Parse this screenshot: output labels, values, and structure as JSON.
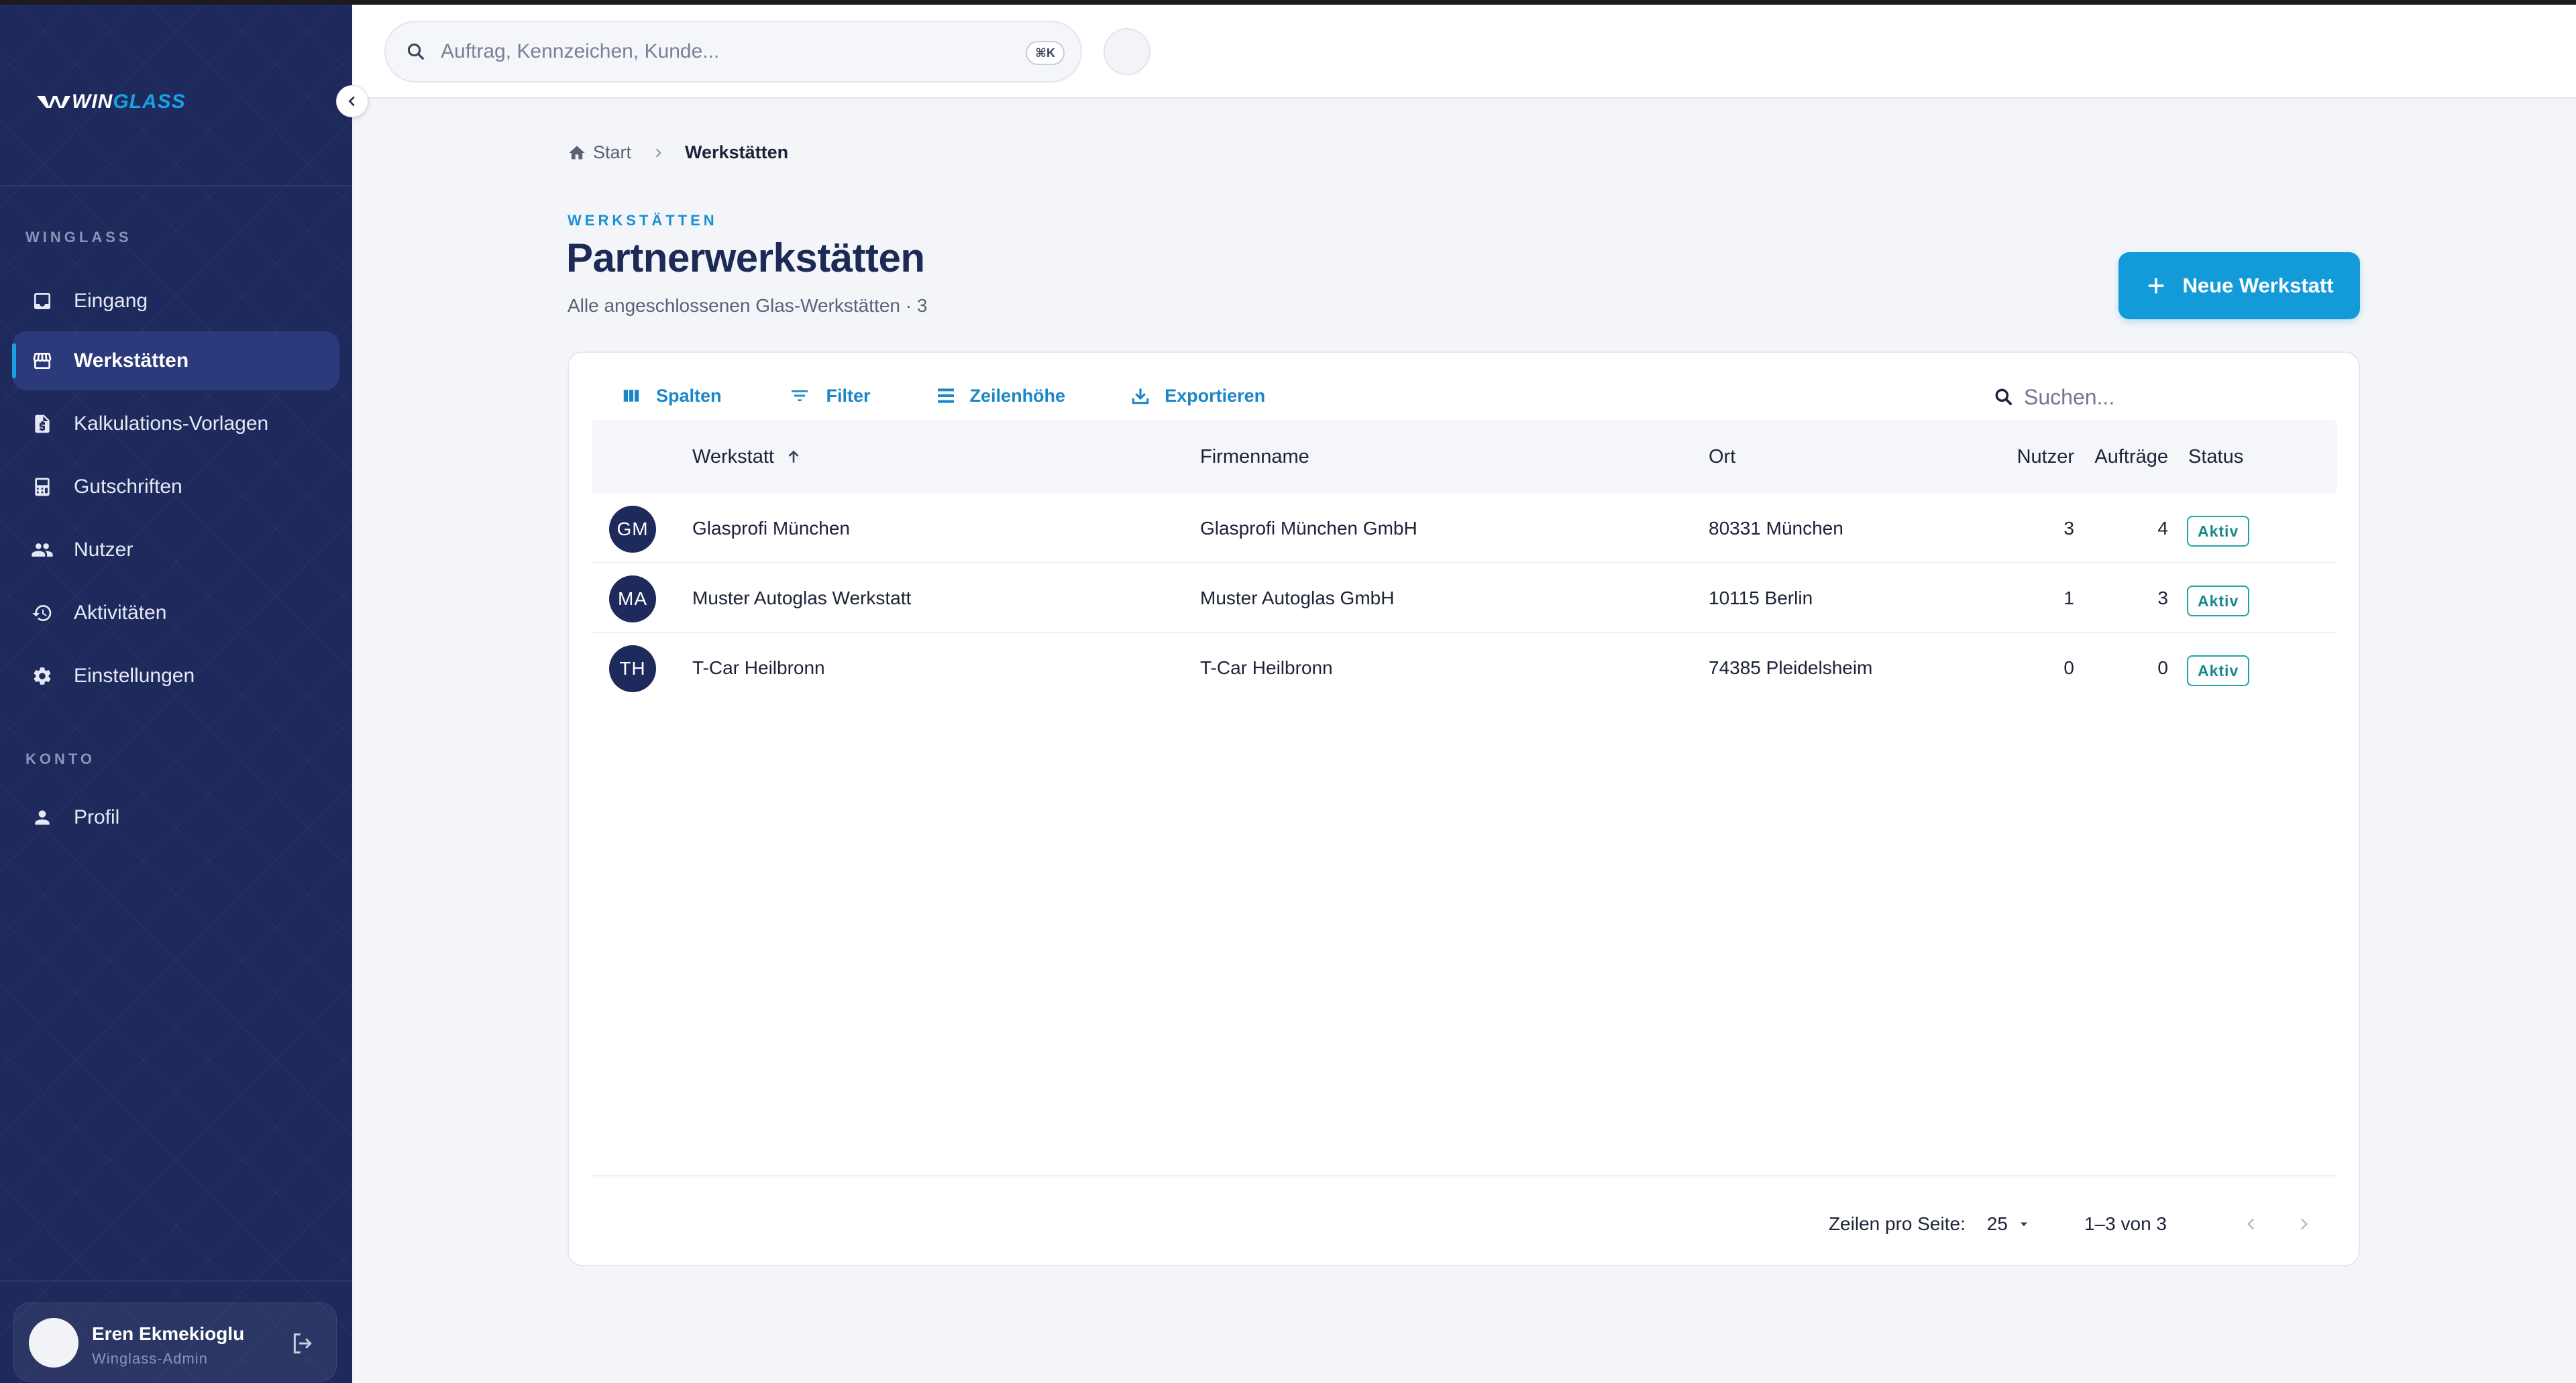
{
  "app": {
    "logo_primary": "WIN",
    "logo_secondary": "GLASS"
  },
  "header": {
    "search_placeholder": "Auftrag, Kennzeichen, Kunde...",
    "shortcut": "⌘K"
  },
  "sidebar": {
    "section_main": "WINGLASS",
    "section_account": "KONTO",
    "items": [
      {
        "label": "Eingang",
        "icon": "inbox-icon"
      },
      {
        "label": "Werkstätten",
        "icon": "store-icon",
        "active": true
      },
      {
        "label": "Kalkulations-Vorlagen",
        "icon": "document-dollar-icon"
      },
      {
        "label": "Gutschriften",
        "icon": "receipt-icon"
      },
      {
        "label": "Nutzer",
        "icon": "users-icon"
      },
      {
        "label": "Aktivitäten",
        "icon": "history-icon"
      },
      {
        "label": "Einstellungen",
        "icon": "gear-icon"
      }
    ],
    "account_items": [
      {
        "label": "Profil",
        "icon": "person-icon"
      }
    ],
    "user": {
      "name": "Eren Ekmekioglu",
      "role": "Winglass-Admin"
    }
  },
  "breadcrumb": {
    "home": "Start",
    "current": "Werkstätten"
  },
  "page": {
    "eyebrow": "WERKSTÄTTEN",
    "title": "Partnerwerkstätten",
    "subtitle": "Alle angeschlossenen Glas-Werkstätten · 3",
    "new_button": "Neue Werkstatt"
  },
  "toolbar": {
    "columns": "Spalten",
    "filter": "Filter",
    "row_height": "Zeilenhöhe",
    "export": "Exportieren",
    "search_placeholder": "Suchen..."
  },
  "table": {
    "headers": {
      "workshop": "Werkstatt",
      "company": "Firmenname",
      "city": "Ort",
      "users": "Nutzer",
      "orders": "Aufträge",
      "status": "Status"
    },
    "rows": [
      {
        "initials": "GM",
        "workshop": "Glasprofi München",
        "company": "Glasprofi München GmbH",
        "city": "80331 München",
        "users": "3",
        "orders": "4",
        "status": "Aktiv"
      },
      {
        "initials": "MA",
        "workshop": "Muster Autoglas Werkstatt",
        "company": "Muster Autoglas GmbH",
        "city": "10115 Berlin",
        "users": "1",
        "orders": "3",
        "status": "Aktiv"
      },
      {
        "initials": "TH",
        "workshop": "T-Car Heilbronn",
        "company": "T-Car Heilbronn",
        "city": "74385 Pleidelsheim",
        "users": "0",
        "orders": "0",
        "status": "Aktiv"
      }
    ]
  },
  "pagination": {
    "rows_per_page_label": "Zeilen pro Seite:",
    "rows_per_page_value": "25",
    "range": "1–3 von 3"
  },
  "colors": {
    "sidebar_bg": "#1f2a5c",
    "accent": "#139ad8",
    "status_active": "#22a4a4"
  }
}
